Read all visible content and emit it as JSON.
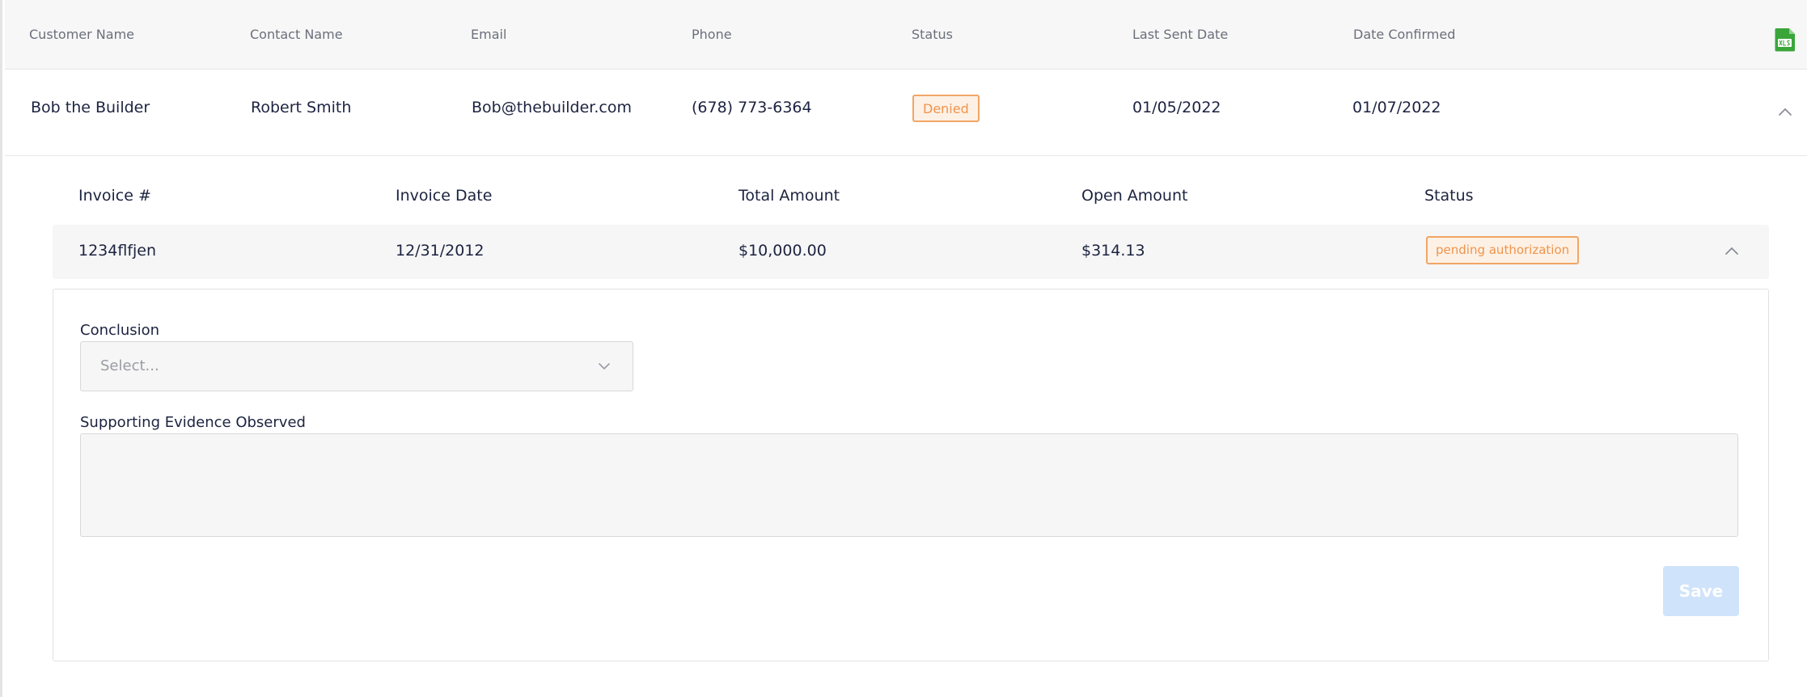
{
  "table": {
    "headers": [
      "Customer Name",
      "Contact Name",
      "Email",
      "Phone",
      "Status",
      "Last Sent Date",
      "Date Confirmed"
    ],
    "export_icon": "xls-file-icon",
    "rows": [
      {
        "customer_name": "Bob the Builder",
        "contact_name": "Robert Smith",
        "email": "Bob@thebuilder.com",
        "phone": "(678) 773-6364",
        "status": "Denied",
        "last_sent_date": "01/05/2022",
        "date_confirmed": "01/07/2022"
      }
    ]
  },
  "invoices": {
    "headers": [
      "Invoice #",
      "Invoice Date",
      "Total Amount",
      "Open Amount",
      "Status"
    ],
    "rows": [
      {
        "invoice_number": "1234flfjen",
        "invoice_date": "12/31/2012",
        "total_amount": "$10,000.00",
        "open_amount": "$314.13",
        "status": "pending authorization"
      }
    ]
  },
  "form": {
    "conclusion_label": "Conclusion",
    "conclusion_placeholder": "Select...",
    "evidence_label": "Supporting Evidence Observed",
    "evidence_value": "",
    "save_label": "Save"
  },
  "colors": {
    "status_warning_text": "#f0944a",
    "status_warning_border": "#f1a664",
    "status_warning_bg": "#fdf1e6",
    "export_icon_green": "#3aa63a",
    "save_button_disabled": "#cfe3fb",
    "text_primary": "#1c2340",
    "header_text": "#6b6f7b"
  }
}
